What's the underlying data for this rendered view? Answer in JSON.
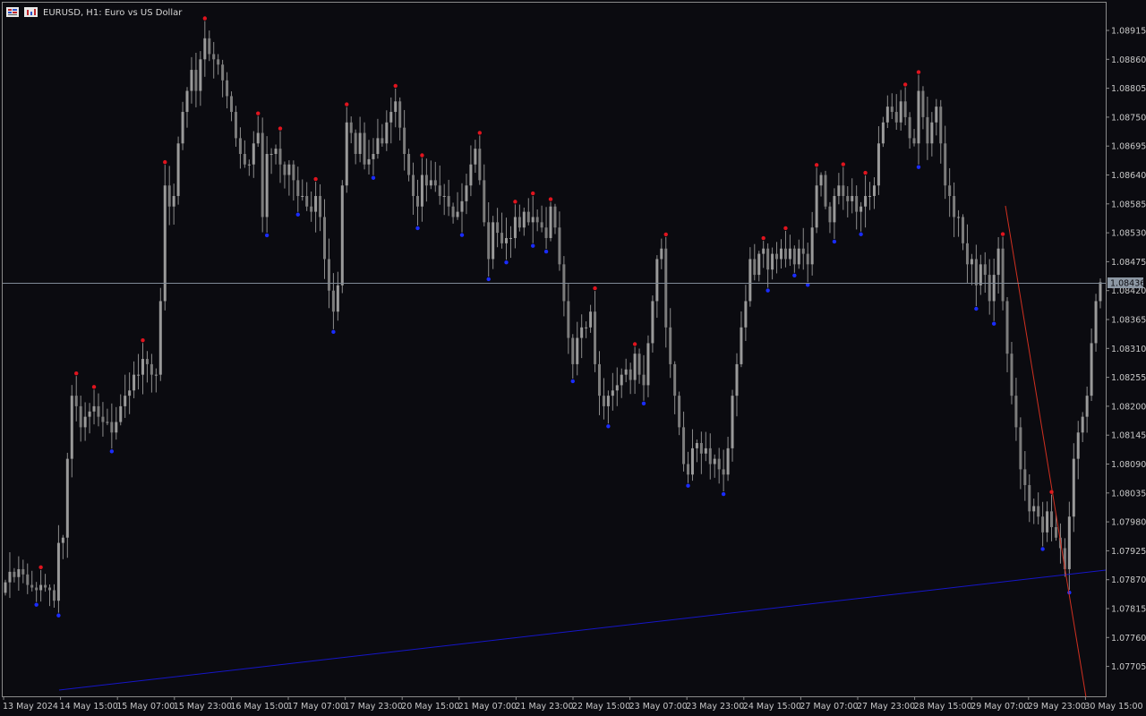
{
  "window": {
    "title": "EURUSD, H1:  Euro vs US Dollar",
    "icons": [
      "chart-menu-icon",
      "chart-type-icon"
    ]
  },
  "colors": {
    "background": "#0b0b10",
    "frame": "#8a8a8a",
    "text": "#c8c8c8",
    "candle": "#8c8c8c",
    "fractal_up": "#e0141e",
    "fractal_down": "#1a2cff",
    "trendline_blue": "#1616c8",
    "trendline_red": "#d03020",
    "price_line": "#7f8a96",
    "price_tag_bg": "#8d98a4"
  },
  "chart_data": {
    "type": "candlestick",
    "symbol": "EURUSD",
    "timeframe": "H1",
    "description": "Euro vs US Dollar",
    "current_price": "1.08436",
    "ylim": [
      1.0767,
      1.0893
    ],
    "y_ticks": [
      "1.08915",
      "1.08860",
      "1.08805",
      "1.08750",
      "1.08695",
      "1.08640",
      "1.08585",
      "1.08530",
      "1.08475",
      "1.08420",
      "1.08365",
      "1.08310",
      "1.08255",
      "1.08200",
      "1.08145",
      "1.08090",
      "1.08035",
      "1.07980",
      "1.07925",
      "1.07870",
      "1.07815",
      "1.07760",
      "1.07705"
    ],
    "x_ticks": [
      "13 May 2024",
      "14 May 15:00",
      "15 May 07:00",
      "15 May 23:00",
      "16 May 15:00",
      "17 May 07:00",
      "17 May 23:00",
      "20 May 15:00",
      "21 May 07:00",
      "21 May 23:00",
      "22 May 15:00",
      "23 May 07:00",
      "23 May 23:00",
      "24 May 15:00",
      "27 May 07:00",
      "27 May 23:00",
      "28 May 15:00",
      "29 May 07:00",
      "29 May 23:00",
      "30 May 15:00"
    ],
    "closes": [
      1.07865,
      1.07885,
      1.07875,
      1.0789,
      1.0788,
      1.0786,
      1.07855,
      1.0785,
      1.0786,
      1.07855,
      1.0785,
      1.0783,
      1.0794,
      1.0795,
      1.081,
      1.0822,
      1.082,
      1.0816,
      1.0818,
      1.0819,
      1.082,
      1.0818,
      1.0817,
      1.0817,
      1.0815,
      1.0817,
      1.082,
      1.0822,
      1.0823,
      1.0826,
      1.0826,
      1.0829,
      1.0828,
      1.0826,
      1.0826,
      1.084,
      1.0862,
      1.0858,
      1.086,
      1.087,
      1.0876,
      1.088,
      1.0884,
      1.088,
      1.0886,
      1.089,
      1.0887,
      1.0886,
      1.0885,
      1.0882,
      1.0879,
      1.0876,
      1.0871,
      1.0868,
      1.0866,
      1.0866,
      1.087,
      1.0872,
      1.0856,
      1.0868,
      1.0868,
      1.0869,
      1.0866,
      1.0864,
      1.0866,
      1.0863,
      1.086,
      1.086,
      1.0858,
      1.0857,
      1.086,
      1.0856,
      1.0848,
      1.0842,
      1.0838,
      1.0843,
      1.0862,
      1.0874,
      1.0872,
      1.0868,
      1.0872,
      1.0866,
      1.0867,
      1.0868,
      1.0871,
      1.087,
      1.0874,
      1.0876,
      1.0878,
      1.0873,
      1.0868,
      1.0864,
      1.086,
      1.0858,
      1.0864,
      1.0862,
      1.0863,
      1.0862,
      1.086,
      1.086,
      1.0858,
      1.0856,
      1.0857,
      1.0859,
      1.0862,
      1.0866,
      1.0869,
      1.0863,
      1.0855,
      1.0848,
      1.0855,
      1.0853,
      1.0851,
      1.0852,
      1.0852,
      1.0856,
      1.0854,
      1.0857,
      1.0855,
      1.0856,
      1.0855,
      1.0854,
      1.0852,
      1.0858,
      1.0854,
      1.0847,
      1.084,
      1.0833,
      1.0828,
      1.0833,
      1.0835,
      1.0835,
      1.0838,
      1.0828,
      1.0822,
      1.082,
      1.0822,
      1.0823,
      1.0824,
      1.0826,
      1.0827,
      1.0825,
      1.083,
      1.0826,
      1.0824,
      1.0832,
      1.084,
      1.0848,
      1.085,
      1.0835,
      1.0828,
      1.0822,
      1.0816,
      1.0809,
      1.0807,
      1.0812,
      1.0813,
      1.0811,
      1.0812,
      1.0809,
      1.081,
      1.0808,
      1.0807,
      1.0812,
      1.0822,
      1.0828,
      1.0835,
      1.084,
      1.0848,
      1.0845,
      1.0849,
      1.085,
      1.0846,
      1.0849,
      1.0848,
      1.085,
      1.0848,
      1.085,
      1.0847,
      1.085,
      1.0849,
      1.0847,
      1.0854,
      1.0862,
      1.0864,
      1.0858,
      1.0855,
      1.086,
      1.0862,
      1.086,
      1.0859,
      1.086,
      1.0857,
      1.0858,
      1.086,
      1.086,
      1.0862,
      1.087,
      1.0874,
      1.0877,
      1.0876,
      1.0874,
      1.0878,
      1.0875,
      1.0871,
      1.087,
      1.088,
      1.0875,
      1.087,
      1.0874,
      1.0877,
      1.087,
      1.0862,
      1.086,
      1.0856,
      1.0856,
      1.0851,
      1.0847,
      1.0848,
      1.0843,
      1.0847,
      1.0845,
      1.084,
      1.0845,
      1.085,
      1.084,
      1.083,
      1.0822,
      1.0816,
      1.0808,
      1.0805,
      1.08,
      1.0801,
      1.0799,
      1.0796,
      1.08,
      1.0797,
      1.0795,
      1.0793,
      1.0789,
      1.0799,
      1.081,
      1.0815,
      1.0818,
      1.0822,
      1.0832,
      1.084,
      1.08436
    ]
  }
}
